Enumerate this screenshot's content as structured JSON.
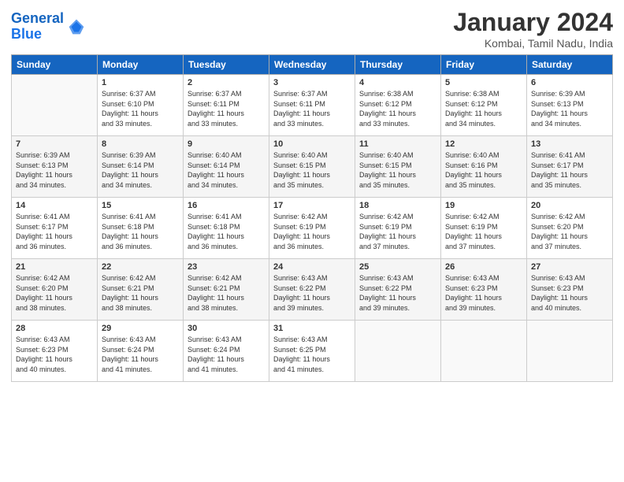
{
  "logo": {
    "line1": "General",
    "line2": "Blue"
  },
  "title": "January 2024",
  "subtitle": "Kombai, Tamil Nadu, India",
  "days_header": [
    "Sunday",
    "Monday",
    "Tuesday",
    "Wednesday",
    "Thursday",
    "Friday",
    "Saturday"
  ],
  "weeks": [
    [
      {
        "day": "",
        "info": ""
      },
      {
        "day": "1",
        "info": "Sunrise: 6:37 AM\nSunset: 6:10 PM\nDaylight: 11 hours\nand 33 minutes."
      },
      {
        "day": "2",
        "info": "Sunrise: 6:37 AM\nSunset: 6:11 PM\nDaylight: 11 hours\nand 33 minutes."
      },
      {
        "day": "3",
        "info": "Sunrise: 6:37 AM\nSunset: 6:11 PM\nDaylight: 11 hours\nand 33 minutes."
      },
      {
        "day": "4",
        "info": "Sunrise: 6:38 AM\nSunset: 6:12 PM\nDaylight: 11 hours\nand 33 minutes."
      },
      {
        "day": "5",
        "info": "Sunrise: 6:38 AM\nSunset: 6:12 PM\nDaylight: 11 hours\nand 34 minutes."
      },
      {
        "day": "6",
        "info": "Sunrise: 6:39 AM\nSunset: 6:13 PM\nDaylight: 11 hours\nand 34 minutes."
      }
    ],
    [
      {
        "day": "7",
        "info": "Sunrise: 6:39 AM\nSunset: 6:13 PM\nDaylight: 11 hours\nand 34 minutes."
      },
      {
        "day": "8",
        "info": "Sunrise: 6:39 AM\nSunset: 6:14 PM\nDaylight: 11 hours\nand 34 minutes."
      },
      {
        "day": "9",
        "info": "Sunrise: 6:40 AM\nSunset: 6:14 PM\nDaylight: 11 hours\nand 34 minutes."
      },
      {
        "day": "10",
        "info": "Sunrise: 6:40 AM\nSunset: 6:15 PM\nDaylight: 11 hours\nand 35 minutes."
      },
      {
        "day": "11",
        "info": "Sunrise: 6:40 AM\nSunset: 6:15 PM\nDaylight: 11 hours\nand 35 minutes."
      },
      {
        "day": "12",
        "info": "Sunrise: 6:40 AM\nSunset: 6:16 PM\nDaylight: 11 hours\nand 35 minutes."
      },
      {
        "day": "13",
        "info": "Sunrise: 6:41 AM\nSunset: 6:17 PM\nDaylight: 11 hours\nand 35 minutes."
      }
    ],
    [
      {
        "day": "14",
        "info": "Sunrise: 6:41 AM\nSunset: 6:17 PM\nDaylight: 11 hours\nand 36 minutes."
      },
      {
        "day": "15",
        "info": "Sunrise: 6:41 AM\nSunset: 6:18 PM\nDaylight: 11 hours\nand 36 minutes."
      },
      {
        "day": "16",
        "info": "Sunrise: 6:41 AM\nSunset: 6:18 PM\nDaylight: 11 hours\nand 36 minutes."
      },
      {
        "day": "17",
        "info": "Sunrise: 6:42 AM\nSunset: 6:19 PM\nDaylight: 11 hours\nand 36 minutes."
      },
      {
        "day": "18",
        "info": "Sunrise: 6:42 AM\nSunset: 6:19 PM\nDaylight: 11 hours\nand 37 minutes."
      },
      {
        "day": "19",
        "info": "Sunrise: 6:42 AM\nSunset: 6:19 PM\nDaylight: 11 hours\nand 37 minutes."
      },
      {
        "day": "20",
        "info": "Sunrise: 6:42 AM\nSunset: 6:20 PM\nDaylight: 11 hours\nand 37 minutes."
      }
    ],
    [
      {
        "day": "21",
        "info": "Sunrise: 6:42 AM\nSunset: 6:20 PM\nDaylight: 11 hours\nand 38 minutes."
      },
      {
        "day": "22",
        "info": "Sunrise: 6:42 AM\nSunset: 6:21 PM\nDaylight: 11 hours\nand 38 minutes."
      },
      {
        "day": "23",
        "info": "Sunrise: 6:42 AM\nSunset: 6:21 PM\nDaylight: 11 hours\nand 38 minutes."
      },
      {
        "day": "24",
        "info": "Sunrise: 6:43 AM\nSunset: 6:22 PM\nDaylight: 11 hours\nand 39 minutes."
      },
      {
        "day": "25",
        "info": "Sunrise: 6:43 AM\nSunset: 6:22 PM\nDaylight: 11 hours\nand 39 minutes."
      },
      {
        "day": "26",
        "info": "Sunrise: 6:43 AM\nSunset: 6:23 PM\nDaylight: 11 hours\nand 39 minutes."
      },
      {
        "day": "27",
        "info": "Sunrise: 6:43 AM\nSunset: 6:23 PM\nDaylight: 11 hours\nand 40 minutes."
      }
    ],
    [
      {
        "day": "28",
        "info": "Sunrise: 6:43 AM\nSunset: 6:23 PM\nDaylight: 11 hours\nand 40 minutes."
      },
      {
        "day": "29",
        "info": "Sunrise: 6:43 AM\nSunset: 6:24 PM\nDaylight: 11 hours\nand 41 minutes."
      },
      {
        "day": "30",
        "info": "Sunrise: 6:43 AM\nSunset: 6:24 PM\nDaylight: 11 hours\nand 41 minutes."
      },
      {
        "day": "31",
        "info": "Sunrise: 6:43 AM\nSunset: 6:25 PM\nDaylight: 11 hours\nand 41 minutes."
      },
      {
        "day": "",
        "info": ""
      },
      {
        "day": "",
        "info": ""
      },
      {
        "day": "",
        "info": ""
      }
    ]
  ]
}
